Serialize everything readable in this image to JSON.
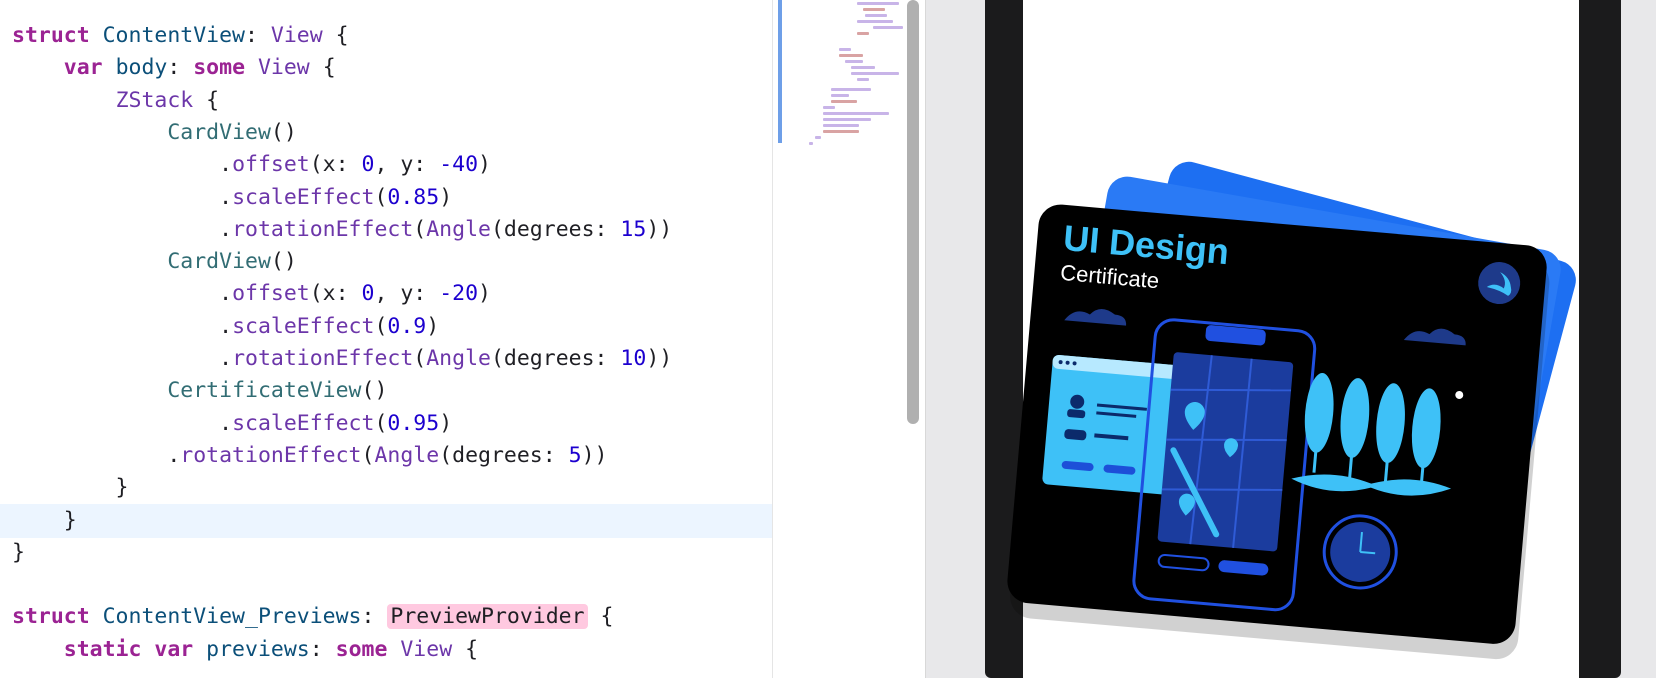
{
  "editor": {
    "lines": [
      [
        {
          "c": "kw",
          "t": "struct "
        },
        {
          "c": "ty",
          "t": "ContentView"
        },
        {
          "c": "pl",
          "t": ": "
        },
        {
          "c": "tf",
          "t": "View"
        },
        {
          "c": "pl",
          "t": " {"
        }
      ],
      [
        {
          "c": "pl",
          "t": "    "
        },
        {
          "c": "kw",
          "t": "var "
        },
        {
          "c": "ty",
          "t": "body"
        },
        {
          "c": "pl",
          "t": ": "
        },
        {
          "c": "kw",
          "t": "some "
        },
        {
          "c": "tf",
          "t": "View"
        },
        {
          "c": "pl",
          "t": " {"
        }
      ],
      [
        {
          "c": "pl",
          "t": "        "
        },
        {
          "c": "tf",
          "t": "ZStack"
        },
        {
          "c": "pl",
          "t": " {"
        }
      ],
      [
        {
          "c": "pl",
          "t": "            "
        },
        {
          "c": "fn",
          "t": "CardView"
        },
        {
          "c": "pl",
          "t": "()"
        }
      ],
      [
        {
          "c": "pl",
          "t": "                ."
        },
        {
          "c": "me",
          "t": "offset"
        },
        {
          "c": "pl",
          "t": "(x: "
        },
        {
          "c": "nu",
          "t": "0"
        },
        {
          "c": "pl",
          "t": ", y: "
        },
        {
          "c": "nu",
          "t": "-40"
        },
        {
          "c": "pl",
          "t": ")"
        }
      ],
      [
        {
          "c": "pl",
          "t": "                ."
        },
        {
          "c": "me",
          "t": "scaleEffect"
        },
        {
          "c": "pl",
          "t": "("
        },
        {
          "c": "nu",
          "t": "0.85"
        },
        {
          "c": "pl",
          "t": ")"
        }
      ],
      [
        {
          "c": "pl",
          "t": "                ."
        },
        {
          "c": "me",
          "t": "rotationEffect"
        },
        {
          "c": "pl",
          "t": "("
        },
        {
          "c": "tf",
          "t": "Angle"
        },
        {
          "c": "pl",
          "t": "(degrees: "
        },
        {
          "c": "nu",
          "t": "15"
        },
        {
          "c": "pl",
          "t": "))"
        }
      ],
      [
        {
          "c": "pl",
          "t": "            "
        },
        {
          "c": "fn",
          "t": "CardView"
        },
        {
          "c": "pl",
          "t": "()"
        }
      ],
      [
        {
          "c": "pl",
          "t": "                ."
        },
        {
          "c": "me",
          "t": "offset"
        },
        {
          "c": "pl",
          "t": "(x: "
        },
        {
          "c": "nu",
          "t": "0"
        },
        {
          "c": "pl",
          "t": ", y: "
        },
        {
          "c": "nu",
          "t": "-20"
        },
        {
          "c": "pl",
          "t": ")"
        }
      ],
      [
        {
          "c": "pl",
          "t": "                ."
        },
        {
          "c": "me",
          "t": "scaleEffect"
        },
        {
          "c": "pl",
          "t": "("
        },
        {
          "c": "nu",
          "t": "0.9"
        },
        {
          "c": "pl",
          "t": ")"
        }
      ],
      [
        {
          "c": "pl",
          "t": "                ."
        },
        {
          "c": "me",
          "t": "rotationEffect"
        },
        {
          "c": "pl",
          "t": "("
        },
        {
          "c": "tf",
          "t": "Angle"
        },
        {
          "c": "pl",
          "t": "(degrees: "
        },
        {
          "c": "nu",
          "t": "10"
        },
        {
          "c": "pl",
          "t": "))"
        }
      ],
      [
        {
          "c": "pl",
          "t": "            "
        },
        {
          "c": "fn",
          "t": "CertificateView"
        },
        {
          "c": "pl",
          "t": "()"
        }
      ],
      [
        {
          "c": "pl",
          "t": "                ."
        },
        {
          "c": "me",
          "t": "scaleEffect"
        },
        {
          "c": "pl",
          "t": "("
        },
        {
          "c": "nu",
          "t": "0.95"
        },
        {
          "c": "pl",
          "t": ")"
        }
      ],
      [
        {
          "c": "pl",
          "t": "            ."
        },
        {
          "c": "me",
          "t": "rotationEffect"
        },
        {
          "c": "pl",
          "t": "("
        },
        {
          "c": "tf",
          "t": "Angle"
        },
        {
          "c": "pl",
          "t": "(degrees: "
        },
        {
          "c": "nu",
          "t": "5"
        },
        {
          "c": "pl",
          "t": "))"
        }
      ],
      [
        {
          "c": "pl",
          "t": "        }"
        }
      ],
      [
        {
          "c": "pl",
          "t": "    }"
        }
      ],
      [
        {
          "c": "pl",
          "t": "}"
        }
      ],
      [
        {
          "c": "pl",
          "t": ""
        }
      ],
      [
        {
          "c": "kw",
          "t": "struct "
        },
        {
          "c": "ty",
          "t": "ContentView_Previews"
        },
        {
          "c": "pl",
          "t": ": "
        },
        {
          "c": "hl",
          "t": "PreviewProvider"
        },
        {
          "c": "pl",
          "t": " {"
        }
      ],
      [
        {
          "c": "pl",
          "t": "    "
        },
        {
          "c": "kw",
          "t": "static "
        },
        {
          "c": "kw",
          "t": "var "
        },
        {
          "c": "ty",
          "t": "previews"
        },
        {
          "c": "pl",
          "t": ": "
        },
        {
          "c": "kw",
          "t": "some "
        },
        {
          "c": "tf",
          "t": "View"
        },
        {
          "c": "pl",
          "t": " {"
        }
      ]
    ],
    "current_line": 15
  },
  "certificate": {
    "title": "UI Design",
    "subtitle": "Certificate",
    "badge_icon": "swift-logo-icon"
  },
  "colors": {
    "keyword": "#9b2393",
    "type": "#0b4f79",
    "number": "#1c00cf",
    "method": "#6c36a9",
    "current_line": "#ecf5ff",
    "card_blue": "#1d6ff2",
    "certificate_bg": "#000000",
    "certificate_accent": "#3ec1f7"
  }
}
